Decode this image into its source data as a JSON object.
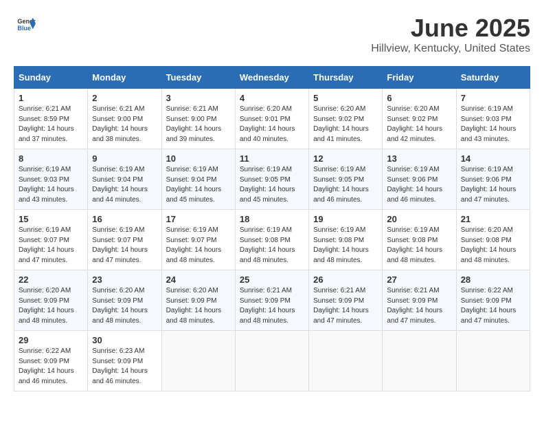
{
  "header": {
    "logo_general": "General",
    "logo_blue": "Blue",
    "title": "June 2025",
    "subtitle": "Hillview, Kentucky, United States"
  },
  "calendar": {
    "days_of_week": [
      "Sunday",
      "Monday",
      "Tuesday",
      "Wednesday",
      "Thursday",
      "Friday",
      "Saturday"
    ],
    "weeks": [
      [
        {
          "day": "1",
          "sunrise": "6:21 AM",
          "sunset": "8:59 PM",
          "daylight": "14 hours and 37 minutes."
        },
        {
          "day": "2",
          "sunrise": "6:21 AM",
          "sunset": "9:00 PM",
          "daylight": "14 hours and 38 minutes."
        },
        {
          "day": "3",
          "sunrise": "6:21 AM",
          "sunset": "9:00 PM",
          "daylight": "14 hours and 39 minutes."
        },
        {
          "day": "4",
          "sunrise": "6:20 AM",
          "sunset": "9:01 PM",
          "daylight": "14 hours and 40 minutes."
        },
        {
          "day": "5",
          "sunrise": "6:20 AM",
          "sunset": "9:02 PM",
          "daylight": "14 hours and 41 minutes."
        },
        {
          "day": "6",
          "sunrise": "6:20 AM",
          "sunset": "9:02 PM",
          "daylight": "14 hours and 42 minutes."
        },
        {
          "day": "7",
          "sunrise": "6:19 AM",
          "sunset": "9:03 PM",
          "daylight": "14 hours and 43 minutes."
        }
      ],
      [
        {
          "day": "8",
          "sunrise": "6:19 AM",
          "sunset": "9:03 PM",
          "daylight": "14 hours and 43 minutes."
        },
        {
          "day": "9",
          "sunrise": "6:19 AM",
          "sunset": "9:04 PM",
          "daylight": "14 hours and 44 minutes."
        },
        {
          "day": "10",
          "sunrise": "6:19 AM",
          "sunset": "9:04 PM",
          "daylight": "14 hours and 45 minutes."
        },
        {
          "day": "11",
          "sunrise": "6:19 AM",
          "sunset": "9:05 PM",
          "daylight": "14 hours and 45 minutes."
        },
        {
          "day": "12",
          "sunrise": "6:19 AM",
          "sunset": "9:05 PM",
          "daylight": "14 hours and 46 minutes."
        },
        {
          "day": "13",
          "sunrise": "6:19 AM",
          "sunset": "9:06 PM",
          "daylight": "14 hours and 46 minutes."
        },
        {
          "day": "14",
          "sunrise": "6:19 AM",
          "sunset": "9:06 PM",
          "daylight": "14 hours and 47 minutes."
        }
      ],
      [
        {
          "day": "15",
          "sunrise": "6:19 AM",
          "sunset": "9:07 PM",
          "daylight": "14 hours and 47 minutes."
        },
        {
          "day": "16",
          "sunrise": "6:19 AM",
          "sunset": "9:07 PM",
          "daylight": "14 hours and 47 minutes."
        },
        {
          "day": "17",
          "sunrise": "6:19 AM",
          "sunset": "9:07 PM",
          "daylight": "14 hours and 48 minutes."
        },
        {
          "day": "18",
          "sunrise": "6:19 AM",
          "sunset": "9:08 PM",
          "daylight": "14 hours and 48 minutes."
        },
        {
          "day": "19",
          "sunrise": "6:19 AM",
          "sunset": "9:08 PM",
          "daylight": "14 hours and 48 minutes."
        },
        {
          "day": "20",
          "sunrise": "6:19 AM",
          "sunset": "9:08 PM",
          "daylight": "14 hours and 48 minutes."
        },
        {
          "day": "21",
          "sunrise": "6:20 AM",
          "sunset": "9:08 PM",
          "daylight": "14 hours and 48 minutes."
        }
      ],
      [
        {
          "day": "22",
          "sunrise": "6:20 AM",
          "sunset": "9:09 PM",
          "daylight": "14 hours and 48 minutes."
        },
        {
          "day": "23",
          "sunrise": "6:20 AM",
          "sunset": "9:09 PM",
          "daylight": "14 hours and 48 minutes."
        },
        {
          "day": "24",
          "sunrise": "6:20 AM",
          "sunset": "9:09 PM",
          "daylight": "14 hours and 48 minutes."
        },
        {
          "day": "25",
          "sunrise": "6:21 AM",
          "sunset": "9:09 PM",
          "daylight": "14 hours and 48 minutes."
        },
        {
          "day": "26",
          "sunrise": "6:21 AM",
          "sunset": "9:09 PM",
          "daylight": "14 hours and 47 minutes."
        },
        {
          "day": "27",
          "sunrise": "6:21 AM",
          "sunset": "9:09 PM",
          "daylight": "14 hours and 47 minutes."
        },
        {
          "day": "28",
          "sunrise": "6:22 AM",
          "sunset": "9:09 PM",
          "daylight": "14 hours and 47 minutes."
        }
      ],
      [
        {
          "day": "29",
          "sunrise": "6:22 AM",
          "sunset": "9:09 PM",
          "daylight": "14 hours and 46 minutes."
        },
        {
          "day": "30",
          "sunrise": "6:23 AM",
          "sunset": "9:09 PM",
          "daylight": "14 hours and 46 minutes."
        },
        null,
        null,
        null,
        null,
        null
      ]
    ]
  }
}
